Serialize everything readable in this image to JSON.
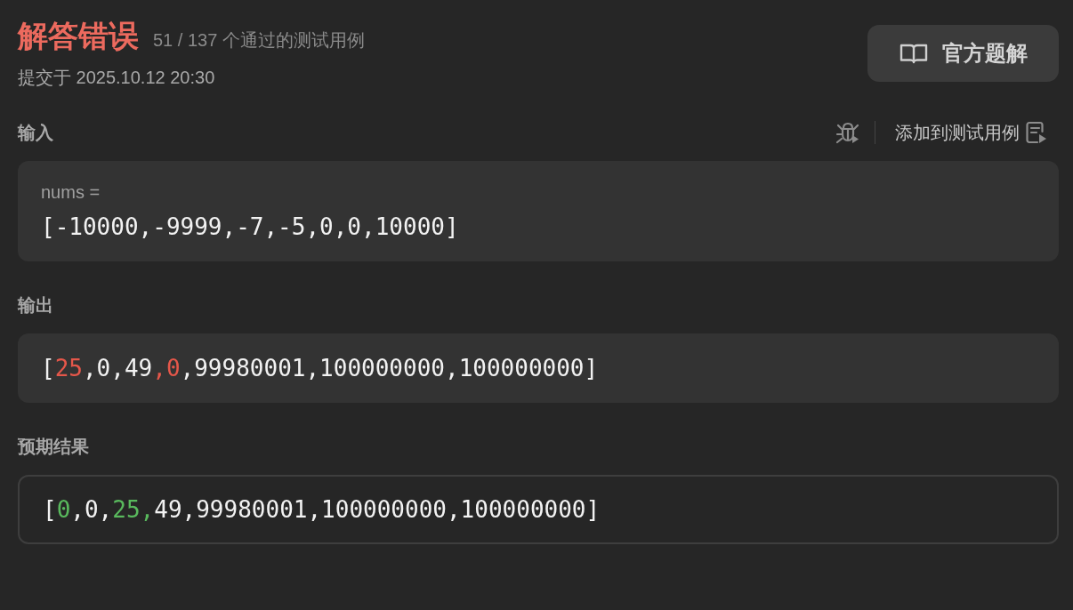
{
  "header": {
    "status": "解答错误",
    "passed": "51 / 137 个通过的测试用例",
    "submitted": "提交于 2025.10.12 20:30",
    "solution_button": "官方题解"
  },
  "input": {
    "label": "输入",
    "add_to_tests": "添加到测试用例",
    "var_name": "nums =",
    "value": "[-10000,-9999,-7,-5,0,0,10000]"
  },
  "output": {
    "label": "输出",
    "segments": [
      {
        "text": "[",
        "kind": "plain"
      },
      {
        "text": "25",
        "kind": "wrong"
      },
      {
        "text": ",0,49",
        "kind": "plain"
      },
      {
        "text": ",0",
        "kind": "wrong"
      },
      {
        "text": ",99980001,100000000,100000000]",
        "kind": "plain"
      }
    ]
  },
  "expected": {
    "label": "预期结果",
    "segments": [
      {
        "text": "[",
        "kind": "plain"
      },
      {
        "text": "0",
        "kind": "right"
      },
      {
        "text": ",0,",
        "kind": "plain"
      },
      {
        "text": "25,",
        "kind": "right"
      },
      {
        "text": "49,99980001,100000000,100000000]",
        "kind": "plain"
      }
    ]
  }
}
